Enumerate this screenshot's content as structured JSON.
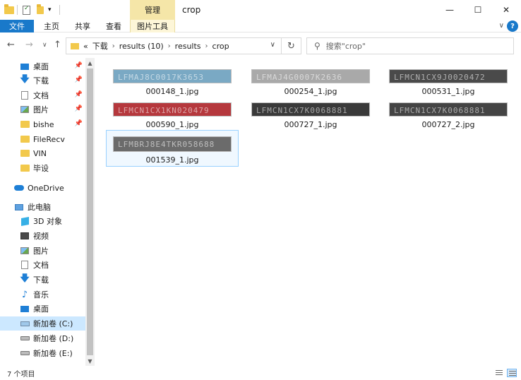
{
  "titlebar": {
    "qa_down": "▾",
    "manage_label": "管理",
    "title": "crop",
    "minimize": "—",
    "maximize": "☐",
    "close": "✕"
  },
  "ribbon": {
    "file": "文件",
    "home": "主页",
    "share": "共享",
    "view": "查看",
    "picture_tools": "图片工具",
    "collapse": "∨",
    "help": "?"
  },
  "nav": {
    "back": "←",
    "forward": "→",
    "recent": "∨",
    "up": "↑",
    "breadcrumb": [
      {
        "label": "«"
      },
      {
        "label": "下载"
      },
      {
        "label": "results (10)"
      },
      {
        "label": "results"
      },
      {
        "label": "crop"
      }
    ],
    "dropdown": "∨",
    "refresh": "↻",
    "search_placeholder": "搜索\"crop\""
  },
  "sidebar": {
    "items": [
      {
        "label": "桌面",
        "icon": "desktop-icon",
        "pinned": true
      },
      {
        "label": "下载",
        "icon": "download-icon",
        "pinned": true
      },
      {
        "label": "文档",
        "icon": "document-icon",
        "pinned": true
      },
      {
        "label": "图片",
        "icon": "picture-icon",
        "pinned": true
      },
      {
        "label": "bishe",
        "icon": "folder-icon",
        "pinned": true
      },
      {
        "label": "FileRecv",
        "icon": "folder-icon",
        "pinned": false
      },
      {
        "label": "VIN",
        "icon": "folder-icon",
        "pinned": false
      },
      {
        "label": "毕设",
        "icon": "folder-icon",
        "pinned": false
      },
      {
        "label": "OneDrive",
        "icon": "onedrive-icon",
        "pinned": false
      },
      {
        "label": "此电脑",
        "icon": "this-pc-icon",
        "pinned": false
      },
      {
        "label": "3D 对象",
        "icon": "3d-objects-icon",
        "pinned": false
      },
      {
        "label": "视频",
        "icon": "video-icon",
        "pinned": false
      },
      {
        "label": "图片",
        "icon": "picture-icon",
        "pinned": false
      },
      {
        "label": "文档",
        "icon": "document-icon",
        "pinned": false
      },
      {
        "label": "下载",
        "icon": "download-icon",
        "pinned": false
      },
      {
        "label": "音乐",
        "icon": "music-icon",
        "pinned": false
      },
      {
        "label": "桌面",
        "icon": "desktop-icon",
        "pinned": false
      },
      {
        "label": "新加卷 (C:)",
        "icon": "drive-c-icon",
        "pinned": false
      },
      {
        "label": "新加卷 (D:)",
        "icon": "drive-icon",
        "pinned": false
      },
      {
        "label": "新加卷 (E:)",
        "icon": "drive-icon",
        "pinned": false
      }
    ],
    "pin_glyph": "📌",
    "scroll_up": "▲",
    "scroll_down": "▼"
  },
  "files": [
    {
      "name": "000148_1.jpg",
      "thumb_text": "LFMAJ8C0017K3653",
      "color": "#7aa9c4"
    },
    {
      "name": "000254_1.jpg",
      "thumb_text": "LFMAJ4G0007K2636",
      "color": "#a9a9a9"
    },
    {
      "name": "000531_1.jpg",
      "thumb_text": "LFMCN1CX9J0020472",
      "color": "#4a4a4a"
    },
    {
      "name": "000590_1.jpg",
      "thumb_text": "LFMCN1CX1KN020479",
      "color": "#b5383d"
    },
    {
      "name": "000727_1.jpg",
      "thumb_text": "LFMCN1CX7K0068881",
      "color": "#3a3a3a"
    },
    {
      "name": "000727_2.jpg",
      "thumb_text": "LFMCN1CX7K0068881",
      "color": "#444444"
    },
    {
      "name": "001539_1.jpg",
      "thumb_text": "LFMBRJ8E4TKR058688",
      "color": "#6b6b6b"
    }
  ],
  "status": {
    "count": "7 个项目"
  }
}
